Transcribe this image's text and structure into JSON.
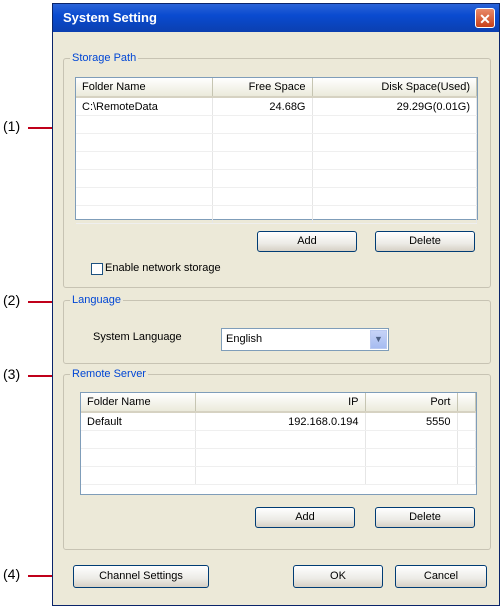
{
  "window": {
    "title": "System Setting",
    "close_glyph": "✕"
  },
  "callouts": [
    "(1)",
    "(2)",
    "(3)",
    "(4)"
  ],
  "storage": {
    "legend": "Storage Path",
    "columns": [
      "Folder Name",
      "Free Space",
      "Disk Space(Used)"
    ],
    "rows": [
      {
        "folder": "C:\\RemoteData",
        "free": "24.68G",
        "disk": "29.29G(0.01G)"
      }
    ],
    "add_label": "Add",
    "delete_label": "Delete",
    "network_checkbox_label": "Enable network storage",
    "network_checked": false
  },
  "language": {
    "legend": "Language",
    "label": "System Language",
    "selected": "English"
  },
  "remote": {
    "legend": "Remote Server",
    "columns": [
      "Folder Name",
      "IP",
      "Port"
    ],
    "rows": [
      {
        "folder": "Default",
        "ip": "192.168.0.194",
        "port": "5550"
      }
    ],
    "add_label": "Add",
    "delete_label": "Delete"
  },
  "footer": {
    "channel_settings_label": "Channel Settings",
    "ok_label": "OK",
    "cancel_label": "Cancel"
  },
  "icons": {
    "close": "close-icon",
    "dropdown": "chevron-down-icon"
  },
  "colors": {
    "titlebar": "#0a4bd0",
    "legend": "#0046d5",
    "callout_line": "#c0001a"
  }
}
